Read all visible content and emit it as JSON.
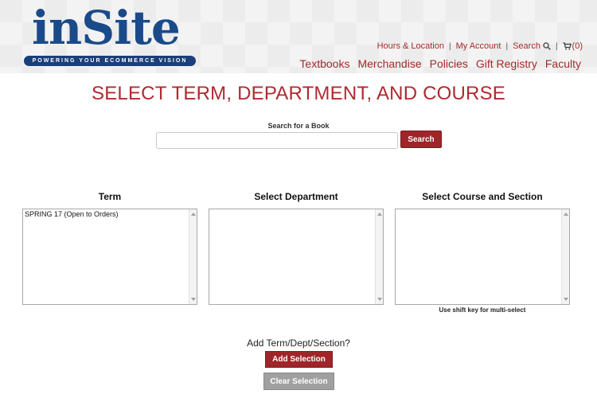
{
  "header": {
    "logo_text": "inSite",
    "logo_tagline": "POWERING YOUR ECOMMERCE VISION",
    "utility_nav": {
      "hours": "Hours & Location",
      "account": "My Account",
      "search": "Search",
      "cart_count": "(0)",
      "separator": "|"
    },
    "main_nav": [
      "Textbooks",
      "Merchandise",
      "Policies",
      "Gift Registry",
      "Faculty"
    ]
  },
  "page_title": "SELECT TERM, DEPARTMENT, AND COURSE",
  "search": {
    "label": "Search for a Book",
    "input_value": "",
    "button_label": "Search"
  },
  "columns": {
    "term": {
      "heading": "Term",
      "options": [
        "SPRING 17 (Open to Orders)"
      ]
    },
    "department": {
      "heading": "Select Department",
      "options": []
    },
    "course": {
      "heading": "Select Course and Section",
      "options": [],
      "hint": "Use shift key for multi-select"
    }
  },
  "actions": {
    "prompt": "Add Term/Dept/Section?",
    "add_label": "Add Selection",
    "clear_label": "Clear Selection"
  },
  "colors": {
    "brand_red": "#a02529",
    "logo_blue": "#1a4a8a",
    "disabled_gray": "#a0a0a0"
  }
}
